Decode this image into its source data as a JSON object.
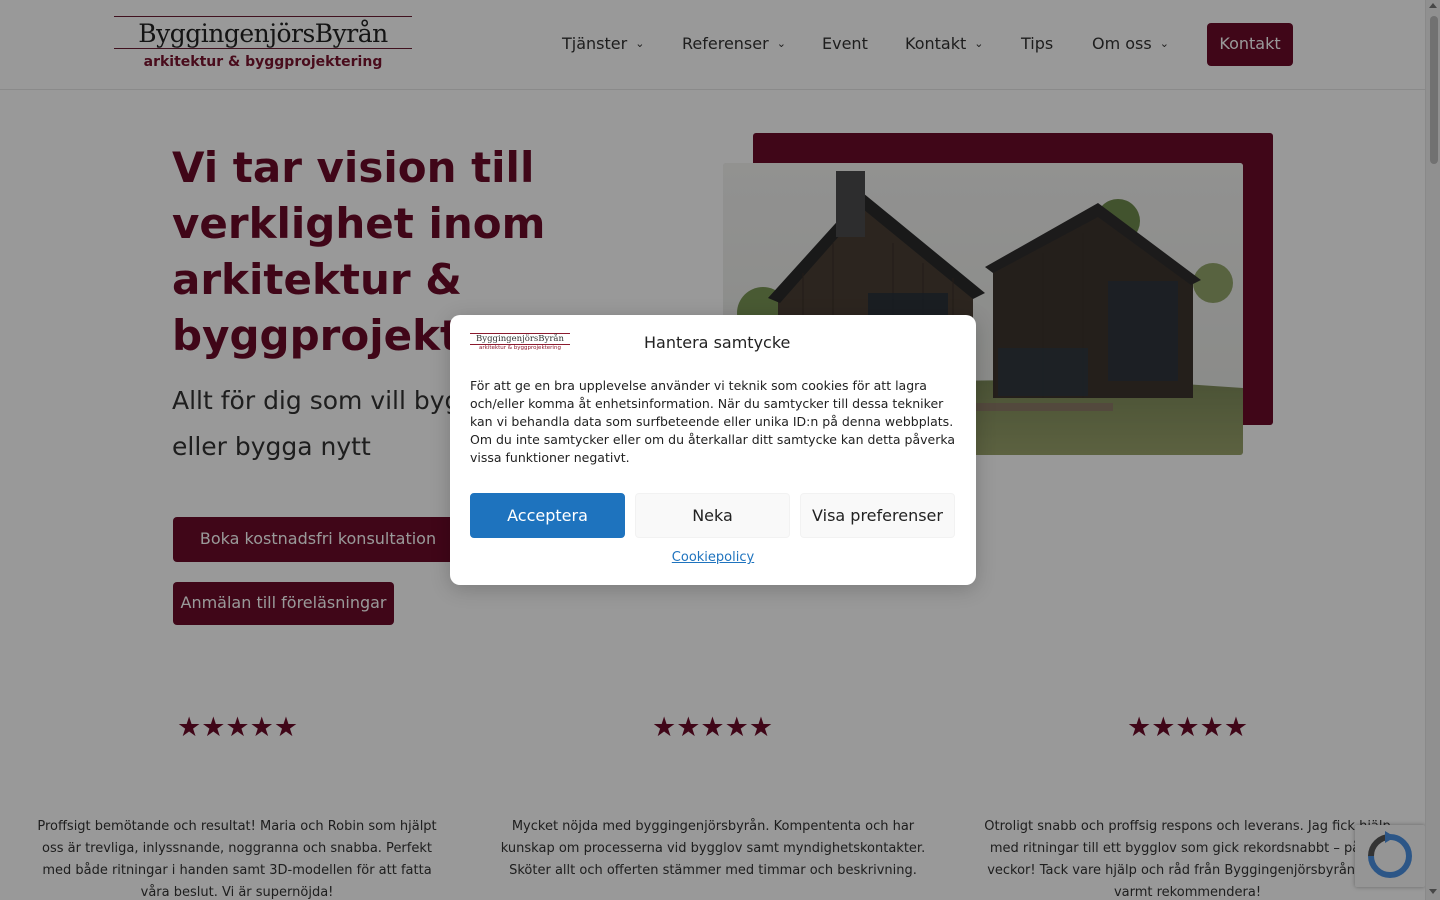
{
  "brand": {
    "name": "ByggingenjörsByrån",
    "tagline": "arkitektur & byggprojektering"
  },
  "nav": {
    "items": [
      {
        "label": "Tjänster",
        "has_dropdown": true
      },
      {
        "label": "Referenser",
        "has_dropdown": true
      },
      {
        "label": "Event",
        "has_dropdown": false
      },
      {
        "label": "Kontakt",
        "has_dropdown": true
      },
      {
        "label": "Tips",
        "has_dropdown": false
      },
      {
        "label": "Om oss",
        "has_dropdown": true
      }
    ],
    "cta_label": "Kontakt",
    "chevron": "chevron-down-icon"
  },
  "hero": {
    "title": "Vi tar vision till verklighet inom arkitektur & byggprojektering",
    "subtitle": "Allt för dig som vill bygga om, bygga till eller bygga nytt",
    "primary_button": "Boka kostnadsfri konsultation",
    "secondary_button": "Anmälan till föreläsningar",
    "image": "modern-wooden-house-photo"
  },
  "reviews": [
    {
      "rating": 5,
      "stars": "★★★★★",
      "text": "Proffsigt bemötande och resultat! Maria och Robin som hjälpt oss är trevliga, inlyssnande, noggranna och snabba. Perfekt med både ritningar i handen samt 3D-modellen för att fatta våra beslut. Vi är supernöjda!"
    },
    {
      "rating": 5,
      "stars": "★★★★★",
      "text": "Mycket nöjda med byggingenjörsbyrån. Kompententa och har kunskap om processerna vid bygglov samt myndighetskontakter. Sköter allt och offerten stämmer med timmar och beskrivning."
    },
    {
      "rating": 5,
      "stars": "★★★★★",
      "text": "Otroligt snabb och proffsig respons och leverans. Jag fick hjälp med ritningar till ett bygglov som gick rekordsnabbt – på två veckor! Tack vare hjälp och råd från Byggingenjörsbyrån. Kan varmt rekommendera!"
    }
  ],
  "consent": {
    "logo_name": "ByggingenjörsByrån",
    "logo_tagline": "arkitektur & byggprojektering",
    "title": "Hantera samtycke",
    "body": "För att ge en bra upplevelse använder vi teknik som cookies för att lagra och/eller komma åt enhetsinformation. När du samtycker till dessa tekniker kan vi behandla data som surfbeteende eller unika ID:n på denna webbplats. Om du inte samtycker eller om du återkallar ditt samtycke kan detta påverka vissa funktioner negativt.",
    "accept": "Acceptera",
    "deny": "Neka",
    "preferences": "Visa preferenser",
    "policy_link": "Cookiepolicy"
  },
  "colors": {
    "brand": "#6b0b28",
    "accept": "#1e73be"
  },
  "recaptcha": {
    "icon": "recaptcha-icon"
  }
}
